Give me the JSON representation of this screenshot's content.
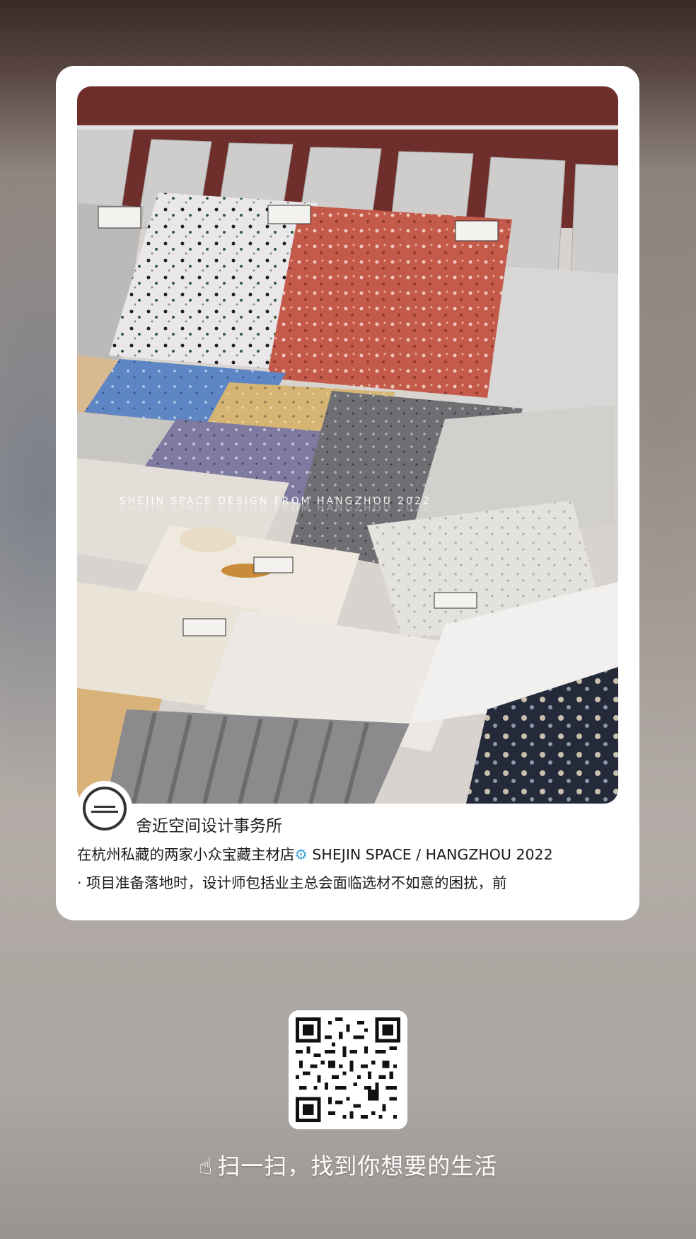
{
  "post": {
    "watermark": "SHEJIN  SPACE  DESIGN    FROM HANGZHOU 2022",
    "account_name": "舍近空间设计事务所",
    "title": "在杭州私藏的两家小众宝藏主材店",
    "title_icon": "gear-icon",
    "title_suffix": " SHEJIN SPACE / HANGZHOU 2022",
    "description": "· 项目准备落地时，设计师包括业主总会面临选材不如意的困扰，前"
  },
  "footer": {
    "scan_icon": "pointing-hand-icon",
    "scan_text": "扫一扫，找到你想要的生活"
  }
}
